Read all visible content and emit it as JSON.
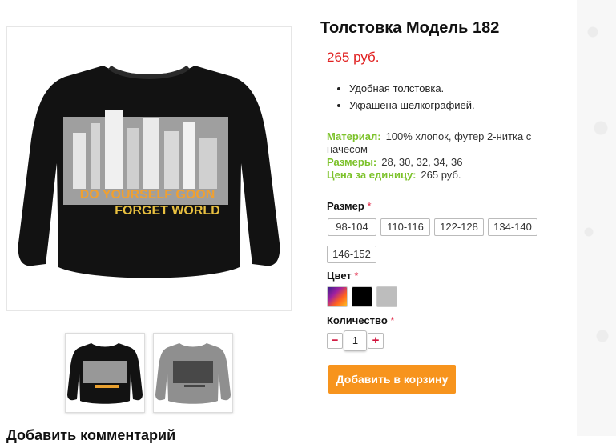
{
  "product": {
    "title": "Толстовка Модель 182",
    "price": "265 руб.",
    "features": [
      "Удобная толстовка.",
      "Украшена шелкографией."
    ],
    "specs": {
      "material_label": "Материал:",
      "material_value": "100% хлопок, футер 2-нитка с начесом",
      "sizes_label": "Размеры:",
      "sizes_value": "28, 30, 32, 34, 36",
      "unit_price_label": "Цена за единицу:",
      "unit_price_value": "265 руб."
    },
    "print_text_line1": "DO YOURSELF GOON",
    "print_text_line2": "FORGET WORLD"
  },
  "options": {
    "size_label": "Размер",
    "sizes": [
      "98-104",
      "110-116",
      "122-128",
      "134-140",
      "146-152"
    ],
    "color_label": "Цвет",
    "colors": [
      "multicolor",
      "#000000",
      "#bdbdbd"
    ],
    "quantity_label": "Количество",
    "quantity": "1",
    "minus": "−",
    "plus": "+",
    "required_mark": "*"
  },
  "actions": {
    "add_to_cart": "Добавить в корзину"
  },
  "comments": {
    "heading": "Добавить комментарий"
  }
}
